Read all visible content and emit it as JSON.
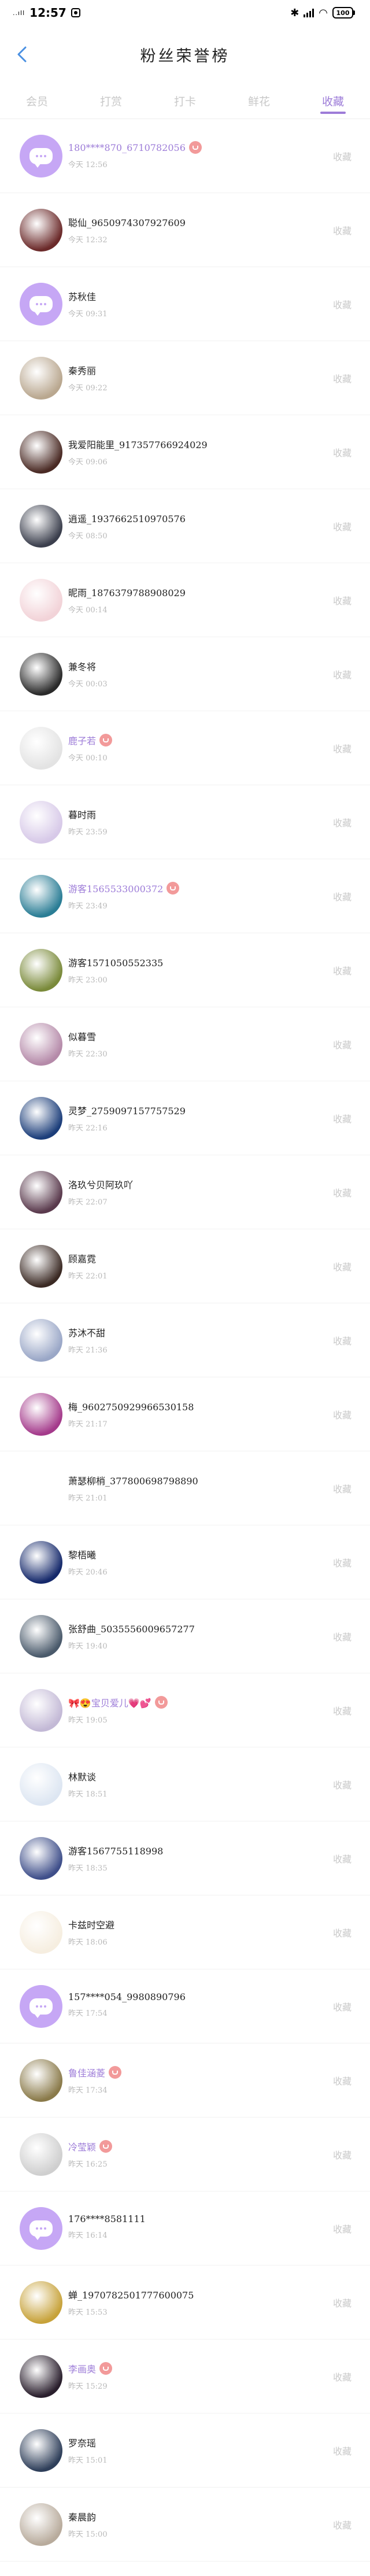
{
  "status": {
    "signal_text": "..ıll",
    "time": "12:57",
    "battery": "100"
  },
  "header": {
    "title": "粉丝荣誉榜"
  },
  "tabs": [
    {
      "label": "会员",
      "active": false
    },
    {
      "label": "打赏",
      "active": false
    },
    {
      "label": "打卡",
      "active": false
    },
    {
      "label": "鲜花",
      "active": false
    },
    {
      "label": "收藏",
      "active": true
    }
  ],
  "fav_label": "收藏",
  "rows": [
    {
      "name": "180****870_6710782056",
      "time": "今天 12:56",
      "badge": true,
      "purple": true,
      "avatar": "default"
    },
    {
      "name": "聪仙_9650974307927609",
      "time": "今天 12:32",
      "badge": false,
      "purple": false,
      "avatar": "#6b2a2a"
    },
    {
      "name": "苏秋佳",
      "time": "今天 09:31",
      "badge": false,
      "purple": false,
      "avatar": "default"
    },
    {
      "name": "秦秀丽",
      "time": "今天 09:22",
      "badge": false,
      "purple": false,
      "avatar": "#b9a78f"
    },
    {
      "name": "我爱阳能里_917357766924029",
      "time": "今天 09:06",
      "badge": false,
      "purple": false,
      "avatar": "#4a2a24"
    },
    {
      "name": "逍遥_1937662510970576",
      "time": "今天 08:50",
      "badge": false,
      "purple": false,
      "avatar": "#3b3f4d"
    },
    {
      "name": "昵雨_1876379788908029",
      "time": "今天 00:14",
      "badge": false,
      "purple": false,
      "avatar": "#f2d3d8"
    },
    {
      "name": "兼冬将",
      "time": "今天 00:03",
      "badge": false,
      "purple": false,
      "avatar": "#2a2a2a"
    },
    {
      "name": "鹿子若",
      "time": "今天 00:10",
      "badge": true,
      "purple": true,
      "avatar": "#e3e3e3"
    },
    {
      "name": "暮时雨",
      "time": "昨天 23:59",
      "badge": false,
      "purple": false,
      "avatar": "#d7c9e8"
    },
    {
      "name": "游客1565533000372",
      "time": "昨天 23:49",
      "badge": true,
      "purple": true,
      "avatar": "#2a7d95"
    },
    {
      "name": "游客1571050552335",
      "time": "昨天 23:00",
      "badge": false,
      "purple": false,
      "avatar": "#7a8a3a"
    },
    {
      "name": "似暮雪",
      "time": "昨天 22:30",
      "badge": false,
      "purple": false,
      "avatar": "#b58aa9"
    },
    {
      "name": "灵梦_2759097157757529",
      "time": "昨天 22:16",
      "badge": false,
      "purple": false,
      "avatar": "#1c3e7a"
    },
    {
      "name": "洛玖兮贝阿玖吖",
      "time": "昨天 22:07",
      "badge": false,
      "purple": false,
      "avatar": "#5a3a4d"
    },
    {
      "name": "顾嘉霓",
      "time": "昨天 22:01",
      "badge": false,
      "purple": false,
      "avatar": "#3b2a24"
    },
    {
      "name": "苏沐不甜",
      "time": "昨天 21:36",
      "badge": false,
      "purple": false,
      "avatar": "#9aa7c7"
    },
    {
      "name": "梅_9602750929966530158",
      "time": "昨天 21:17",
      "badge": false,
      "purple": false,
      "avatar": "#a43a8b"
    },
    {
      "name": "萧瑟柳梢_377800698798890",
      "time": "昨天 21:01",
      "badge": false,
      "purple": false,
      "avatar": "none"
    },
    {
      "name": "黎梧曦",
      "time": "昨天 20:46",
      "badge": false,
      "purple": false,
      "avatar": "#15296b"
    },
    {
      "name": "张舒曲_5035556009657277",
      "time": "昨天 19:40",
      "badge": false,
      "purple": false,
      "avatar": "#4a5a6b"
    },
    {
      "name": "🎀😍宝贝爱儿💗💕",
      "time": "昨天 19:05",
      "badge": true,
      "purple": true,
      "avatar": "#c3b9d6"
    },
    {
      "name": "林默谈",
      "time": "昨天 18:51",
      "badge": false,
      "purple": false,
      "avatar": "#dde6f2"
    },
    {
      "name": "游客1567755118998",
      "time": "昨天 18:35",
      "badge": false,
      "purple": false,
      "avatar": "#3f4f8a"
    },
    {
      "name": "卡兹时空避",
      "time": "昨天 18:06",
      "badge": false,
      "purple": false,
      "avatar": "#f6eee0"
    },
    {
      "name": "157****054_9980890796",
      "time": "昨天 17:54",
      "badge": false,
      "purple": false,
      "avatar": "default"
    },
    {
      "name": "鲁佳涵菱",
      "time": "昨天 17:34",
      "badge": true,
      "purple": true,
      "avatar": "#8a7a4a"
    },
    {
      "name": "冷莹颖",
      "time": "昨天 16:25",
      "badge": true,
      "purple": true,
      "avatar": "#cfcfcf"
    },
    {
      "name": "176****8581111",
      "time": "昨天 16:14",
      "badge": false,
      "purple": false,
      "avatar": "default"
    },
    {
      "name": "蝉_1970782501777600075",
      "time": "昨天 15:53",
      "badge": false,
      "purple": false,
      "avatar": "#c7a23a"
    },
    {
      "name": "李画奥",
      "time": "昨天 15:29",
      "badge": true,
      "purple": true,
      "avatar": "#2a1f2d"
    },
    {
      "name": "罗奈瑶",
      "time": "昨天 15:01",
      "badge": false,
      "purple": false,
      "avatar": "#2f3f5a"
    },
    {
      "name": "秦晨韵",
      "time": "昨天 15:00",
      "badge": false,
      "purple": false,
      "avatar": "#b8ab9c"
    }
  ]
}
